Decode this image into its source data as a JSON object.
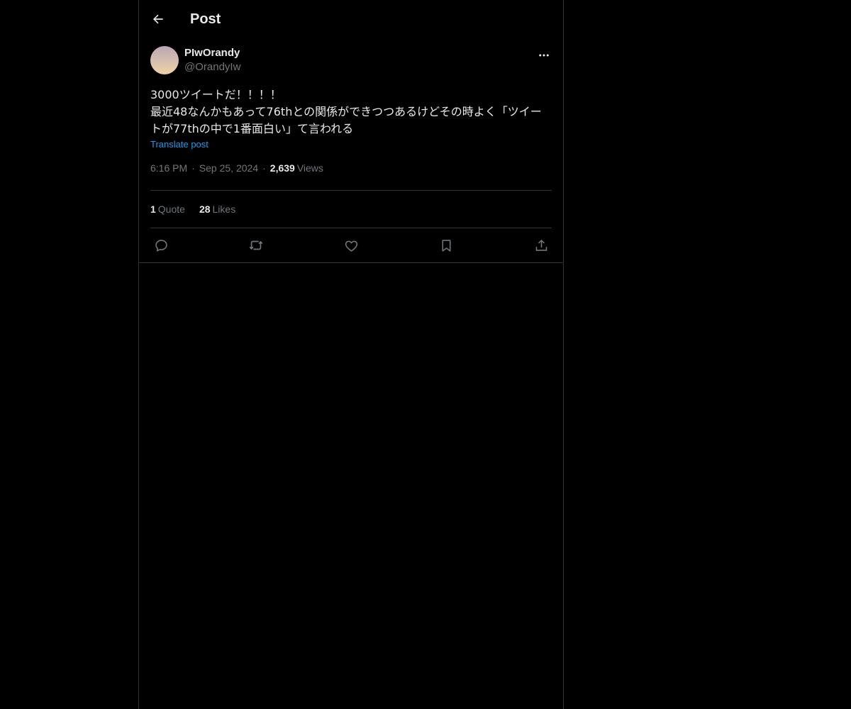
{
  "header": {
    "title": "Post"
  },
  "post": {
    "author": {
      "display_name": "PIwOrandy",
      "handle": "@OrandyIw"
    },
    "text": "3000ツイートだ！！！！\n最近48なんかもあって76thとの関係ができつつあるけどその時よく「ツイートが77thの中で1番面白い」て言われる",
    "translate_label": "Translate post",
    "time": "6:16 PM",
    "date": "Sep 25, 2024",
    "separator": "·",
    "views_count": "2,639",
    "views_label": "Views",
    "stats": {
      "quote_count": "1",
      "quote_label": "Quote",
      "likes_count": "28",
      "likes_label": "Likes"
    }
  },
  "colors": {
    "background": "#000000",
    "text_primary": "#e7e9ea",
    "text_secondary": "#71767b",
    "accent": "#1d9bf0",
    "border": "#2f3336"
  },
  "icons": {
    "back": "arrow-left-icon",
    "more": "more-horizontal-icon",
    "reply": "reply-icon",
    "repost": "repost-icon",
    "like": "heart-icon",
    "bookmark": "bookmark-icon",
    "share": "share-icon"
  }
}
